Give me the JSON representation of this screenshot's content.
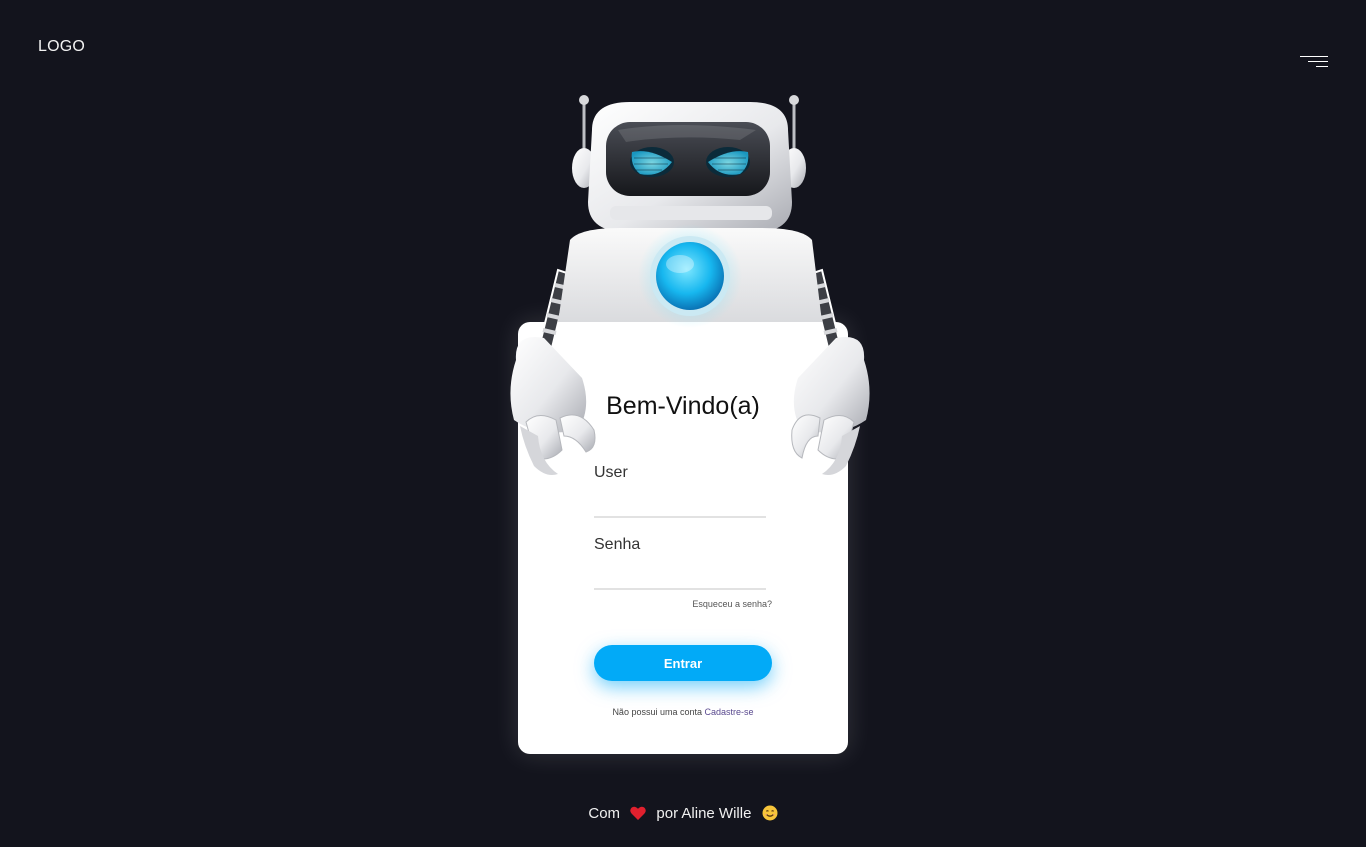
{
  "header": {
    "logo_text": "LOGO",
    "menu_icon": "hamburger-menu-icon"
  },
  "login_card": {
    "title": "Bem-Vindo(a)",
    "user_label": "User",
    "user_value": "",
    "password_label": "Senha",
    "password_value": "",
    "forgot_password": "Esqueceu a senha?",
    "submit_label": "Entrar",
    "signup_prompt": "Não possui uma conta",
    "signup_link": "Cadastre-se"
  },
  "footer": {
    "prefix": "Com",
    "middle": "por Aline Wille",
    "heart_icon": "heart-icon",
    "smile_icon": "smile-emoji-icon"
  },
  "colors": {
    "background": "#13141d",
    "accent": "#02aaf7",
    "card": "#ffffff",
    "link": "#5a4a8f"
  }
}
